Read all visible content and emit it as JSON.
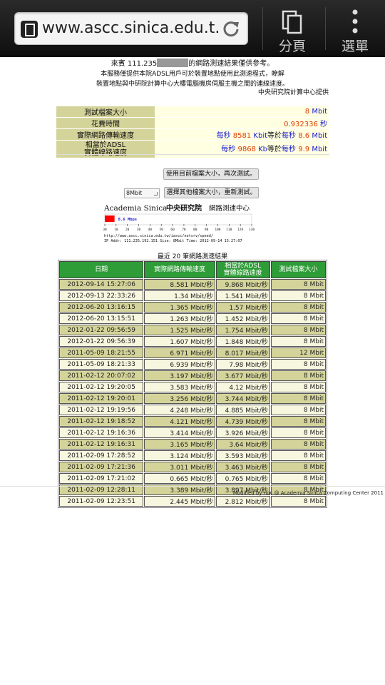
{
  "browser": {
    "url": "www.ascc.sinica.edu.t.",
    "tabs_label": "分頁",
    "menu_label": "選單",
    "icons": {
      "site": "page-icon",
      "reload": "reload-icon",
      "tabs": "tabs-icon",
      "menu": "more-vert-icon"
    }
  },
  "intro": {
    "line1_prefix": "來賓 111.235",
    "line1_suffix": "的網路測速結果僅供參考。",
    "line2": "本服務僅提供本院ADSL用戶可於裝置地點使用此測速程式，瞭解",
    "line3": "裝置地點與中研院計算中心大樓電腦機房伺服主機之間的連線速度。",
    "provider": "中央研究院計算中心提供"
  },
  "info": {
    "rows": [
      {
        "label": "測試檔案大小",
        "parts": [
          {
            "t": "8 ",
            "c": "red"
          },
          {
            "t": "Mbit",
            "c": "blue"
          }
        ]
      },
      {
        "label": "花費時間",
        "parts": [
          {
            "t": "0.932336 ",
            "c": "red"
          },
          {
            "t": "秒",
            "c": "blue"
          }
        ]
      },
      {
        "label": "實際網路傳輸速度",
        "parts": [
          {
            "t": "每秒 ",
            "c": "blue"
          },
          {
            "t": "8581 ",
            "c": "red"
          },
          {
            "t": "Kbit",
            "c": "blue"
          },
          {
            "t": "等於",
            "c": "black"
          },
          {
            "t": "每秒 ",
            "c": "blue"
          },
          {
            "t": "8.6 ",
            "c": "red"
          },
          {
            "t": "Mbit",
            "c": "blue"
          }
        ]
      },
      {
        "label": "相當於ADSL\n實體線路速度",
        "parts": [
          {
            "t": "每秒 ",
            "c": "blue"
          },
          {
            "t": "9868 ",
            "c": "red"
          },
          {
            "t": "Kb",
            "c": "blue"
          },
          {
            "t": "等於",
            "c": "black"
          },
          {
            "t": "每秒 ",
            "c": "blue"
          },
          {
            "t": "9.9 ",
            "c": "red"
          },
          {
            "t": "Mbit",
            "c": "blue"
          }
        ]
      }
    ]
  },
  "actions": {
    "retest_label": "使用目前檔案大小，再次測試。",
    "size_select_value": "8Mbit",
    "other_size_label": "選擇其他檔案大小，重新測試。"
  },
  "speed_image": {
    "title_en": "Academia Sinica",
    "title_zh": "中央研究院",
    "title_right": "網路測速中心",
    "speed_label": "8.6 Mbps",
    "speed_mbps": 8.6,
    "scale_max": 130,
    "ticks": [
      "00",
      "10",
      "20",
      "30",
      "40",
      "50",
      "60",
      "70",
      "80",
      "90",
      "100",
      "110",
      "120",
      "130"
    ],
    "url_line": "http://www.ascc.sinica.edu.tw/iascc/netsrv/speed/",
    "ip_line": "IP Addr: 111.235.192.151 Size: 8Mbit Time: 2012-09-14 15:27:07",
    "bar_color": "#ff0000"
  },
  "history": {
    "title": "最近 20 筆網路測速結果",
    "headers": [
      "日期",
      "實際網路傳輸速度",
      "相當於ADSL\n實體線路速度",
      "測試檔案大小"
    ],
    "rows": [
      [
        "2012-09-14 15:27:06",
        "8.581 Mbit/秒",
        "9.868 Mbit/秒",
        "8 Mbit"
      ],
      [
        "2012-09-13 22:33:26",
        "1.34 Mbit/秒",
        "1.541 Mbit/秒",
        "8 Mbit"
      ],
      [
        "2012-06-20 13:16:15",
        "1.365 Mbit/秒",
        "1.57 Mbit/秒",
        "8 Mbit"
      ],
      [
        "2012-06-20 13:15:51",
        "1.263 Mbit/秒",
        "1.452 Mbit/秒",
        "8 Mbit"
      ],
      [
        "2012-01-22 09:56:59",
        "1.525 Mbit/秒",
        "1.754 Mbit/秒",
        "8 Mbit"
      ],
      [
        "2012-01-22 09:56:39",
        "1.607 Mbit/秒",
        "1.848 Mbit/秒",
        "8 Mbit"
      ],
      [
        "2011-05-09 18:21:55",
        "6.971 Mbit/秒",
        "8.017 Mbit/秒",
        "12 Mbit"
      ],
      [
        "2011-05-09 18:21:33",
        "6.939 Mbit/秒",
        "7.98 Mbit/秒",
        "8 Mbit"
      ],
      [
        "2011-02-12 20:07:02",
        "3.197 Mbit/秒",
        "3.677 Mbit/秒",
        "8 Mbit"
      ],
      [
        "2011-02-12 19:20:05",
        "3.583 Mbit/秒",
        "4.12 Mbit/秒",
        "8 Mbit"
      ],
      [
        "2011-02-12 19:20:01",
        "3.256 Mbit/秒",
        "3.744 Mbit/秒",
        "8 Mbit"
      ],
      [
        "2011-02-12 19:19:56",
        "4.248 Mbit/秒",
        "4.885 Mbit/秒",
        "8 Mbit"
      ],
      [
        "2011-02-12 19:18:52",
        "4.121 Mbit/秒",
        "4.739 Mbit/秒",
        "8 Mbit"
      ],
      [
        "2011-02-12 19:16:36",
        "3.414 Mbit/秒",
        "3.926 Mbit/秒",
        "8 Mbit"
      ],
      [
        "2011-02-12 19:16:31",
        "3.165 Mbit/秒",
        "3.64 Mbit/秒",
        "8 Mbit"
      ],
      [
        "2011-02-09 17:28:52",
        "3.124 Mbit/秒",
        "3.593 Mbit/秒",
        "8 Mbit"
      ],
      [
        "2011-02-09 17:21:36",
        "3.011 Mbit/秒",
        "3.463 Mbit/秒",
        "8 Mbit"
      ],
      [
        "2011-02-09 17:21:02",
        "0.665 Mbit/秒",
        "0.765 Mbit/秒",
        "8 Mbit"
      ],
      [
        "2011-02-09 12:28:11",
        "3.389 Mbit/秒",
        "3.897 Mbit/秒",
        "8 Mbit"
      ],
      [
        "2011-02-09 12:23:51",
        "2.445 Mbit/秒",
        "2.812 Mbit/秒",
        "8 Mbit"
      ]
    ]
  },
  "footer": "Modified by noc @ Academia Sinica Computing Center 2011",
  "colors": {
    "label_bg": "#d4d49a",
    "value_bg": "#ffffe2",
    "header_green": "#2e9c37",
    "value_red": "#e03b00",
    "value_blue": "#1a1ad0"
  }
}
